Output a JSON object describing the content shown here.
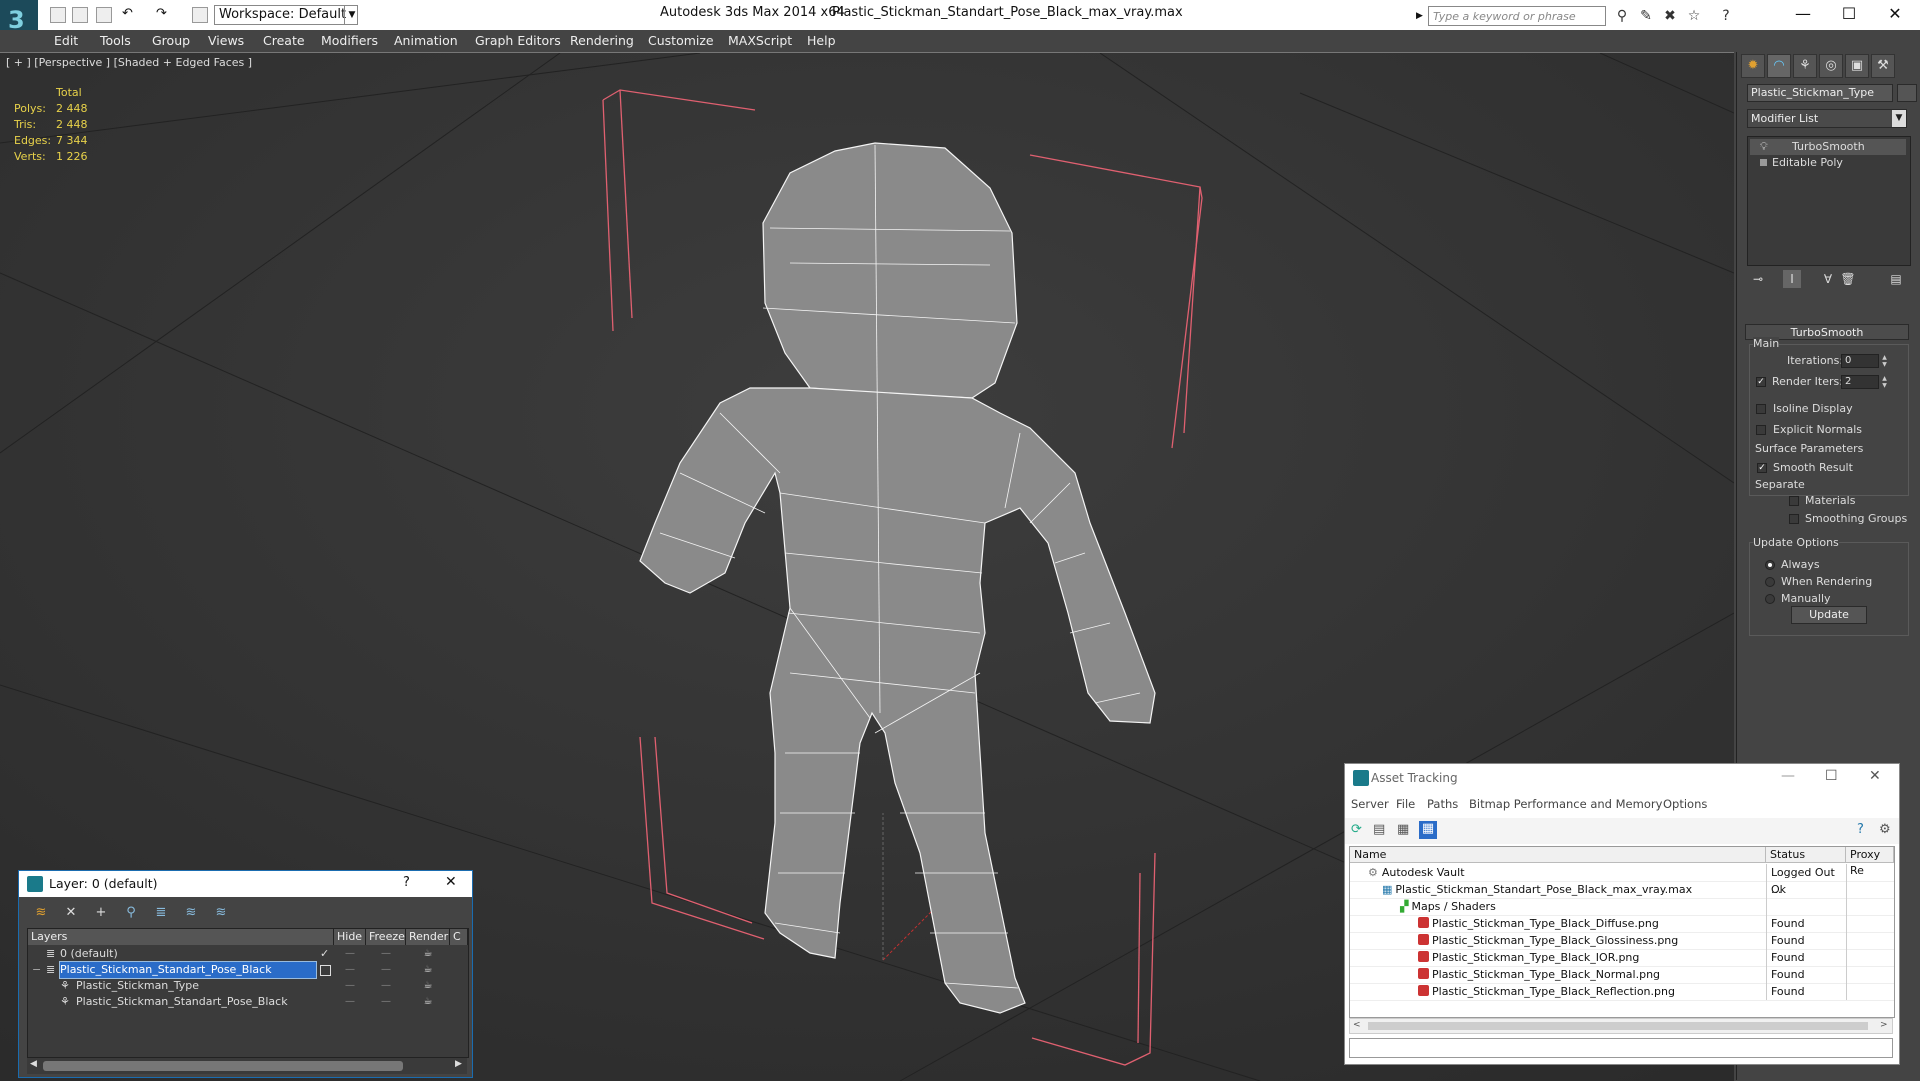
{
  "titlebar": {
    "workspace": "Workspace: Default",
    "app_title": "Autodesk 3ds Max  2014 x64",
    "file_title": "Plastic_Stickman_Standart_Pose_Black_max_vray.max",
    "search_placeholder": "Type a keyword or phrase",
    "minimize": "—",
    "maximize": "☐",
    "close": "✕"
  },
  "menu": [
    "Edit",
    "Tools",
    "Group",
    "Views",
    "Create",
    "Modifiers",
    "Animation",
    "Graph Editors",
    "Rendering",
    "Customize",
    "MAXScript",
    "Help"
  ],
  "viewport": {
    "label": "[ + ] [Perspective ] [Shaded + Edged Faces ]",
    "stats_header": "Total",
    "stats": [
      {
        "label": "Polys:",
        "value": "2 448"
      },
      {
        "label": "Tris:",
        "value": "2 448"
      },
      {
        "label": "Edges:",
        "value": "7 344"
      },
      {
        "label": "Verts:",
        "value": "1 226"
      }
    ]
  },
  "command_panel": {
    "object_name": "Plastic_Stickman_Type",
    "modifier_list": "Modifier List",
    "stack": [
      "TurboSmooth",
      "Editable Poly"
    ],
    "rollout_title": "TurboSmooth",
    "main_group": "Main",
    "iterations_label": "Iterations:",
    "iterations_value": "0",
    "render_iters_label": "Render Iters:",
    "render_iters_value": "2",
    "isoline_label": "Isoline Display",
    "explicit_normals_label": "Explicit Normals",
    "surface_group": "Surface Parameters",
    "smooth_result_label": "Smooth Result",
    "separate_label": "Separate",
    "materials_label": "Materials",
    "smoothing_groups_label": "Smoothing Groups",
    "update_group": "Update Options",
    "always_label": "Always",
    "when_rendering_label": "When Rendering",
    "manually_label": "Manually",
    "update_button": "Update"
  },
  "layer_dialog": {
    "title": "Layer: 0 (default)",
    "help": "?",
    "close": "✕",
    "columns": [
      "Layers",
      "Hide",
      "Freeze",
      "Render",
      "C"
    ],
    "rows": [
      {
        "name": "0 (default)",
        "indent": 1,
        "selected": false
      },
      {
        "name": "Plastic_Stickman_Standart_Pose_Black",
        "indent": 1,
        "selected": true
      },
      {
        "name": "Plastic_Stickman_Type",
        "indent": 2,
        "selected": false
      },
      {
        "name": "Plastic_Stickman_Standart_Pose_Black",
        "indent": 2,
        "selected": false
      }
    ]
  },
  "asset_tracking": {
    "title": "Asset Tracking",
    "menu": [
      "Server",
      "File",
      "Paths",
      "Bitmap Performance and Memory",
      "Options"
    ],
    "columns": [
      "Name",
      "Status",
      "Proxy Re"
    ],
    "rows": [
      {
        "name": "Autodesk Vault",
        "status": "Logged Out ...",
        "indent": 1
      },
      {
        "name": "Plastic_Stickman_Standart_Pose_Black_max_vray.max",
        "status": "Ok",
        "indent": 2
      },
      {
        "name": "Maps / Shaders",
        "status": "",
        "indent": 3
      },
      {
        "name": "Plastic_Stickman_Type_Black_Diffuse.png",
        "status": "Found",
        "indent": 4
      },
      {
        "name": "Plastic_Stickman_Type_Black_Glossiness.png",
        "status": "Found",
        "indent": 4
      },
      {
        "name": "Plastic_Stickman_Type_Black_IOR.png",
        "status": "Found",
        "indent": 4
      },
      {
        "name": "Plastic_Stickman_Type_Black_Normal.png",
        "status": "Found",
        "indent": 4
      },
      {
        "name": "Plastic_Stickman_Type_Black_Reflection.png",
        "status": "Found",
        "indent": 4
      }
    ]
  }
}
